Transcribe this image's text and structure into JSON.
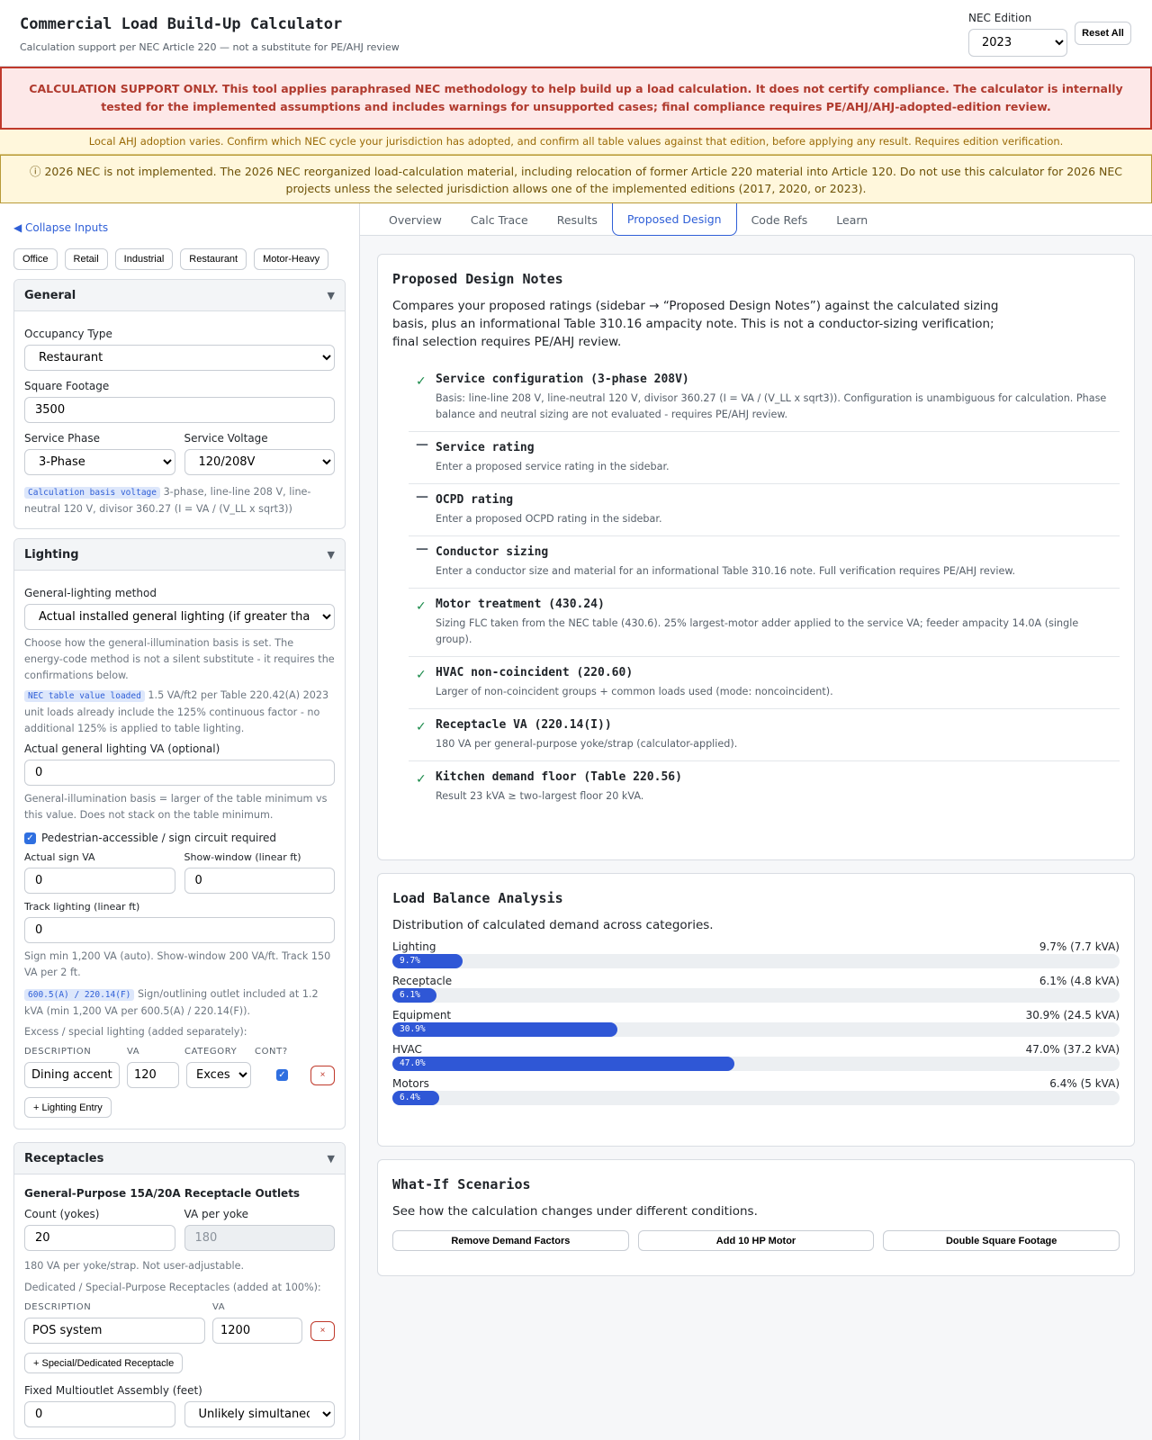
{
  "header": {
    "title": "Commercial Load Build-Up Calculator",
    "subtitle": "Calculation support per NEC Article 220 — not a substitute for PE/AHJ review",
    "edition_label": "NEC Edition",
    "edition_value": "2023",
    "reset_label": "Reset All"
  },
  "banners": {
    "disclaimer": "CALCULATION SUPPORT ONLY. This tool applies paraphrased NEC methodology to help build up a load calculation. It does not certify compliance. The calculator is internally tested for the implemented assumptions and includes warnings for unsupported cases; final compliance requires PE/AHJ/AHJ-adopted-edition review.",
    "ahj_note": "Local AHJ adoption varies. Confirm which NEC cycle your jurisdiction has adopted, and confirm all table values against that edition, before applying any result. Requires edition verification.",
    "nec2026": "ⓘ 2026 NEC is not implemented. The 2026 NEC reorganized load-calculation material, including relocation of former Article 220 material into Article 120. Do not use this calculator for 2026 NEC projects unless the selected jurisdiction allows one of the implemented editions (2017, 2020, or 2023)."
  },
  "sidebar": {
    "collapse_label": "◀ Collapse Inputs",
    "presets": [
      "Office",
      "Retail",
      "Industrial",
      "Restaurant",
      "Motor-Heavy"
    ],
    "general": {
      "title": "General",
      "occupancy_label": "Occupancy Type",
      "occupancy_value": "Restaurant",
      "sqft_label": "Square Footage",
      "sqft_value": "3500",
      "phase_label": "Service Phase",
      "phase_value": "3-Phase",
      "voltage_label": "Service Voltage",
      "voltage_value": "120/208V",
      "basis_tag": "Calculation basis voltage",
      "basis_text": "3-phase, line-line 208 V, line-neutral 120 V, divisor 360.27 (I = VA / (V_LL x sqrt3))"
    },
    "lighting": {
      "title": "Lighting",
      "method_label": "General-lighting method",
      "method_value": "Actual installed general lighting (if greater than",
      "method_hint": "Choose how the general-illumination basis is set. The energy-code method is not a silent substitute - it requires the confirmations below.",
      "table_tag": "NEC table value loaded",
      "table_text": "1.5 VA/ft2 per Table 220.42(A) 2023 unit loads already include the 125% continuous factor - no additional 125% is applied to table lighting.",
      "actual_label": "Actual general lighting VA (optional)",
      "actual_value": "0",
      "actual_hint": "General-illumination basis = larger of the table minimum vs this value. Does not stack on the table minimum.",
      "sign_check_label": "Pedestrian-accessible / sign circuit required",
      "sign_va_label": "Actual sign VA",
      "sign_va_value": "0",
      "show_window_label": "Show-window (linear ft)",
      "show_window_value": "0",
      "track_label": "Track lighting (linear ft)",
      "track_value": "0",
      "track_hint": "Sign min 1,200 VA (auto). Show-window 200 VA/ft. Track 150 VA per 2 ft.",
      "sign_tag": "600.5(A) / 220.14(F)",
      "sign_text": "Sign/outlining outlet included at 1.2 kVA (min 1,200 VA per 600.5(A) / 220.14(F)).",
      "excess_hint": "Excess / special lighting (added separately):",
      "table_headers": [
        "DESCRIPTION",
        "VA",
        "CATEGORY",
        "CONT?"
      ],
      "entry": {
        "description": "Dining accent",
        "va": "120",
        "category": "Excess"
      },
      "remove_label": "×",
      "add_label": "+ Lighting Entry"
    },
    "receptacles": {
      "title": "Receptacles",
      "gp_title": "General-Purpose 15A/20A Receptacle Outlets",
      "count_label": "Count (yokes)",
      "count_value": "20",
      "va_label": "VA per yoke",
      "va_value": "180",
      "va_hint": "180 VA per yoke/strap. Not user-adjustable.",
      "dedicated_hint": "Dedicated / Special-Purpose Receptacles (added at 100%):",
      "table_headers": [
        "DESCRIPTION",
        "VA"
      ],
      "entry": {
        "description": "POS system",
        "va": "1200"
      },
      "remove_label": "×",
      "add_label": "+ Special/Dedicated Receptacle",
      "mao_label": "Fixed Multioutlet Assembly (feet)",
      "mao_value": "0",
      "mao_usage": "Unlikely simultaneo"
    }
  },
  "tabs": [
    "Overview",
    "Calc Trace",
    "Results",
    "Proposed Design",
    "Code Refs",
    "Learn"
  ],
  "active_tab": "Proposed Design",
  "design_notes": {
    "title": "Proposed Design Notes",
    "description": "Compares your proposed ratings (sidebar → “Proposed Design Notes”) against the calculated sizing basis, plus an informational Table 310.16 ampacity note. This is not a conductor-sizing verification; final selection requires PE/AHJ review.",
    "items": [
      {
        "status": "ok",
        "mark": "✓",
        "title": "Service configuration (3-phase 208V)",
        "detail": "Basis: line-line 208 V, line-neutral 120 V, divisor 360.27 (I = VA / (V_LL x sqrt3)). Configuration is unambiguous for calculation. Phase balance and neutral sizing are not evaluated - requires PE/AHJ review."
      },
      {
        "status": "na",
        "mark": "—",
        "title": "Service rating",
        "detail": "Enter a proposed service rating in the sidebar."
      },
      {
        "status": "na",
        "mark": "—",
        "title": "OCPD rating",
        "detail": "Enter a proposed OCPD rating in the sidebar."
      },
      {
        "status": "na",
        "mark": "—",
        "title": "Conductor sizing",
        "detail": "Enter a conductor size and material for an informational Table 310.16 note. Full verification requires PE/AHJ review."
      },
      {
        "status": "ok",
        "mark": "✓",
        "title": "Motor treatment (430.24)",
        "detail": "Sizing FLC taken from the NEC table (430.6). 25% largest-motor adder applied to the service VA; feeder ampacity 14.0A (single group)."
      },
      {
        "status": "ok",
        "mark": "✓",
        "title": "HVAC non-coincident (220.60)",
        "detail": "Larger of non-coincident groups + common loads used (mode: noncoincident)."
      },
      {
        "status": "ok",
        "mark": "✓",
        "title": "Receptacle VA (220.14(I))",
        "detail": "180 VA per general-purpose yoke/strap (calculator-applied)."
      },
      {
        "status": "ok",
        "mark": "✓",
        "title": "Kitchen demand floor (Table 220.56)",
        "detail": "Result 23 kVA ≥ two-largest floor 20 kVA."
      }
    ]
  },
  "load_balance": {
    "title": "Load Balance Analysis",
    "description": "Distribution of calculated demand across categories.",
    "rows": [
      {
        "name": "Lighting",
        "percent": 9.7,
        "pct_label": "9.7%",
        "summary": "9.7% (7.7 kVA)"
      },
      {
        "name": "Receptacle",
        "percent": 6.1,
        "pct_label": "6.1%",
        "summary": "6.1% (4.8 kVA)"
      },
      {
        "name": "Equipment",
        "percent": 30.9,
        "pct_label": "30.9%",
        "summary": "30.9% (24.5 kVA)"
      },
      {
        "name": "HVAC",
        "percent": 47.0,
        "pct_label": "47.0%",
        "summary": "47.0% (37.2 kVA)"
      },
      {
        "name": "Motors",
        "percent": 6.4,
        "pct_label": "6.4%",
        "summary": "6.4% (5 kVA)"
      }
    ]
  },
  "whatif": {
    "title": "What-If Scenarios",
    "description": "See how the calculation changes under different conditions.",
    "buttons": [
      "Remove Demand Factors",
      "Add 10 HP Motor",
      "Double Square Footage"
    ]
  }
}
